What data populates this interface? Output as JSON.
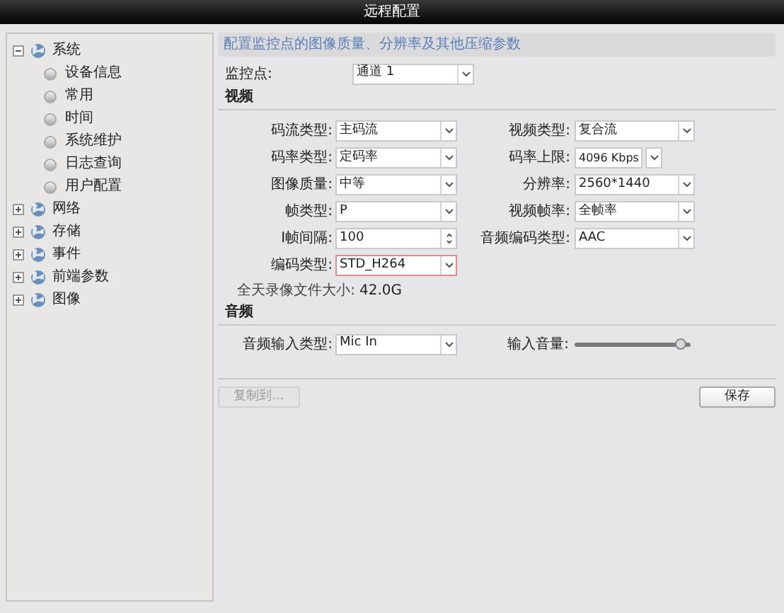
{
  "window": {
    "title": "远程配置"
  },
  "tree": [
    {
      "label": "系统",
      "expanded": true,
      "children": [
        {
          "label": "设备信息"
        },
        {
          "label": "常用"
        },
        {
          "label": "时间"
        },
        {
          "label": "系统维护"
        },
        {
          "label": "日志查询"
        },
        {
          "label": "用户配置"
        }
      ]
    },
    {
      "label": "网络",
      "expanded": false
    },
    {
      "label": "存储",
      "expanded": false
    },
    {
      "label": "事件",
      "expanded": false
    },
    {
      "label": "前端参数",
      "expanded": false
    },
    {
      "label": "图像",
      "expanded": false
    }
  ],
  "header": "配置监控点的图像质量、分辨率及其他压缩参数",
  "channel": {
    "label": "监控点:",
    "value": "通道 1"
  },
  "video": {
    "title": "视频",
    "rows": [
      {
        "left": {
          "kind": "select",
          "label": "码流类型:",
          "value": "主码流",
          "highlighted": false
        },
        "right": {
          "kind": "select",
          "label": "视频类型:",
          "value": "复合流",
          "highlighted": false
        }
      },
      {
        "left": {
          "kind": "select",
          "label": "码率类型:",
          "value": "定码率",
          "highlighted": false
        },
        "right": {
          "kind": "short-select",
          "label": "码率上限:",
          "value": "4096 Kbps",
          "highlighted": false
        }
      },
      {
        "left": {
          "kind": "select",
          "label": "图像质量:",
          "value": "中等",
          "highlighted": false
        },
        "right": {
          "kind": "select",
          "label": "分辨率:",
          "value": "2560*1440",
          "highlighted": false
        }
      },
      {
        "left": {
          "kind": "select",
          "label": "帧类型:",
          "value": "P",
          "highlighted": false
        },
        "right": {
          "kind": "select",
          "label": "视频帧率:",
          "value": "全帧率",
          "highlighted": false
        }
      },
      {
        "left": {
          "kind": "spin",
          "label": "I帧间隔:",
          "value": "100",
          "highlighted": false
        },
        "right": {
          "kind": "select",
          "label": "音频编码类型:",
          "value": "AAC",
          "highlighted": false
        }
      },
      {
        "left": {
          "kind": "select",
          "label": "编码类型:",
          "value": "STD_H264",
          "highlighted": true
        }
      }
    ],
    "file_size": {
      "label": "全天录像文件大小:",
      "value": "42.0G"
    }
  },
  "audio": {
    "title": "音频",
    "input": {
      "label": "音频输入类型:",
      "value": "Mic In"
    },
    "volume": {
      "label": "输入音量:",
      "level": 0.92
    }
  },
  "buttons": [
    {
      "label": "复制到...",
      "disabled": true
    },
    {
      "label": "保存",
      "disabled": false
    }
  ]
}
